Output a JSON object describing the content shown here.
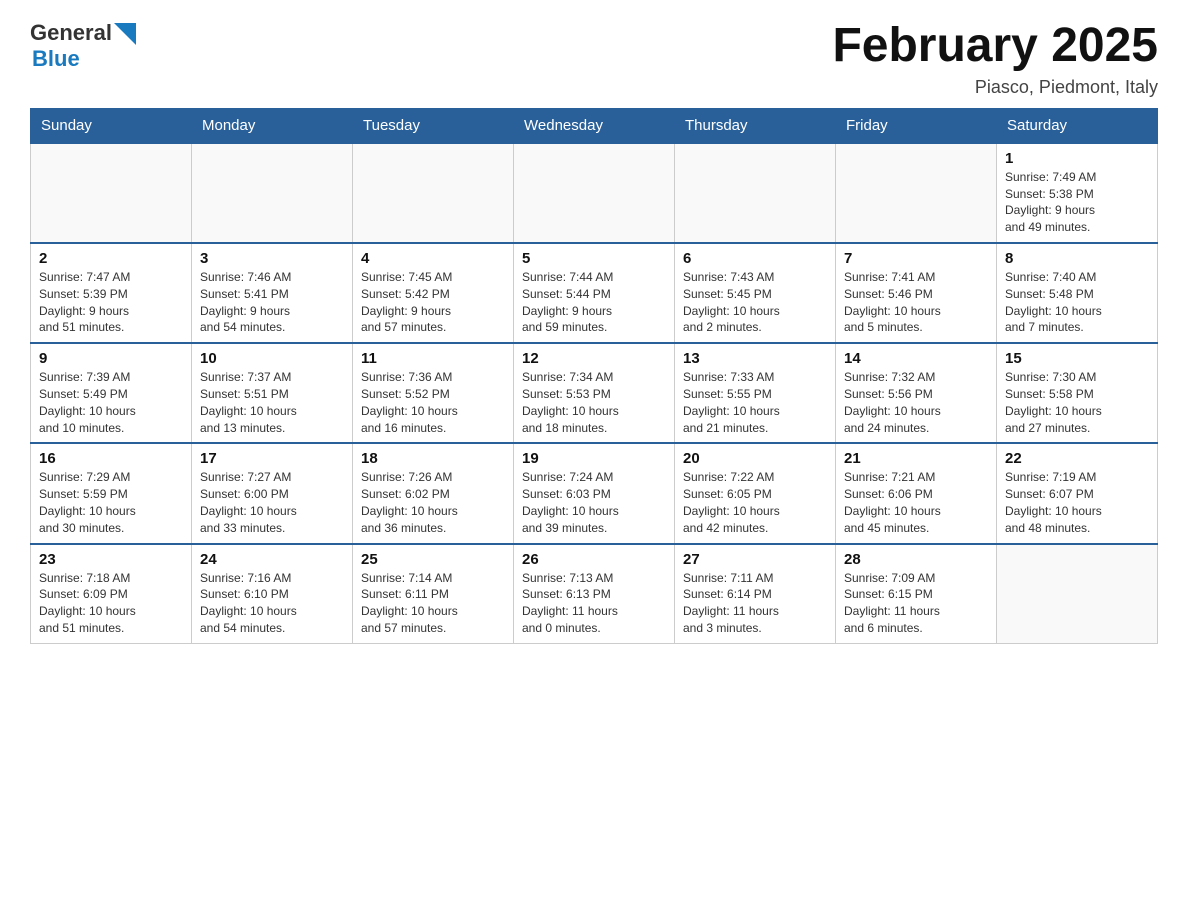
{
  "header": {
    "logo_general": "General",
    "logo_blue": "Blue",
    "month_title": "February 2025",
    "subtitle": "Piasco, Piedmont, Italy"
  },
  "weekdays": [
    "Sunday",
    "Monday",
    "Tuesday",
    "Wednesday",
    "Thursday",
    "Friday",
    "Saturday"
  ],
  "weeks": [
    [
      {
        "day": "",
        "info": ""
      },
      {
        "day": "",
        "info": ""
      },
      {
        "day": "",
        "info": ""
      },
      {
        "day": "",
        "info": ""
      },
      {
        "day": "",
        "info": ""
      },
      {
        "day": "",
        "info": ""
      },
      {
        "day": "1",
        "info": "Sunrise: 7:49 AM\nSunset: 5:38 PM\nDaylight: 9 hours\nand 49 minutes."
      }
    ],
    [
      {
        "day": "2",
        "info": "Sunrise: 7:47 AM\nSunset: 5:39 PM\nDaylight: 9 hours\nand 51 minutes."
      },
      {
        "day": "3",
        "info": "Sunrise: 7:46 AM\nSunset: 5:41 PM\nDaylight: 9 hours\nand 54 minutes."
      },
      {
        "day": "4",
        "info": "Sunrise: 7:45 AM\nSunset: 5:42 PM\nDaylight: 9 hours\nand 57 minutes."
      },
      {
        "day": "5",
        "info": "Sunrise: 7:44 AM\nSunset: 5:44 PM\nDaylight: 9 hours\nand 59 minutes."
      },
      {
        "day": "6",
        "info": "Sunrise: 7:43 AM\nSunset: 5:45 PM\nDaylight: 10 hours\nand 2 minutes."
      },
      {
        "day": "7",
        "info": "Sunrise: 7:41 AM\nSunset: 5:46 PM\nDaylight: 10 hours\nand 5 minutes."
      },
      {
        "day": "8",
        "info": "Sunrise: 7:40 AM\nSunset: 5:48 PM\nDaylight: 10 hours\nand 7 minutes."
      }
    ],
    [
      {
        "day": "9",
        "info": "Sunrise: 7:39 AM\nSunset: 5:49 PM\nDaylight: 10 hours\nand 10 minutes."
      },
      {
        "day": "10",
        "info": "Sunrise: 7:37 AM\nSunset: 5:51 PM\nDaylight: 10 hours\nand 13 minutes."
      },
      {
        "day": "11",
        "info": "Sunrise: 7:36 AM\nSunset: 5:52 PM\nDaylight: 10 hours\nand 16 minutes."
      },
      {
        "day": "12",
        "info": "Sunrise: 7:34 AM\nSunset: 5:53 PM\nDaylight: 10 hours\nand 18 minutes."
      },
      {
        "day": "13",
        "info": "Sunrise: 7:33 AM\nSunset: 5:55 PM\nDaylight: 10 hours\nand 21 minutes."
      },
      {
        "day": "14",
        "info": "Sunrise: 7:32 AM\nSunset: 5:56 PM\nDaylight: 10 hours\nand 24 minutes."
      },
      {
        "day": "15",
        "info": "Sunrise: 7:30 AM\nSunset: 5:58 PM\nDaylight: 10 hours\nand 27 minutes."
      }
    ],
    [
      {
        "day": "16",
        "info": "Sunrise: 7:29 AM\nSunset: 5:59 PM\nDaylight: 10 hours\nand 30 minutes."
      },
      {
        "day": "17",
        "info": "Sunrise: 7:27 AM\nSunset: 6:00 PM\nDaylight: 10 hours\nand 33 minutes."
      },
      {
        "day": "18",
        "info": "Sunrise: 7:26 AM\nSunset: 6:02 PM\nDaylight: 10 hours\nand 36 minutes."
      },
      {
        "day": "19",
        "info": "Sunrise: 7:24 AM\nSunset: 6:03 PM\nDaylight: 10 hours\nand 39 minutes."
      },
      {
        "day": "20",
        "info": "Sunrise: 7:22 AM\nSunset: 6:05 PM\nDaylight: 10 hours\nand 42 minutes."
      },
      {
        "day": "21",
        "info": "Sunrise: 7:21 AM\nSunset: 6:06 PM\nDaylight: 10 hours\nand 45 minutes."
      },
      {
        "day": "22",
        "info": "Sunrise: 7:19 AM\nSunset: 6:07 PM\nDaylight: 10 hours\nand 48 minutes."
      }
    ],
    [
      {
        "day": "23",
        "info": "Sunrise: 7:18 AM\nSunset: 6:09 PM\nDaylight: 10 hours\nand 51 minutes."
      },
      {
        "day": "24",
        "info": "Sunrise: 7:16 AM\nSunset: 6:10 PM\nDaylight: 10 hours\nand 54 minutes."
      },
      {
        "day": "25",
        "info": "Sunrise: 7:14 AM\nSunset: 6:11 PM\nDaylight: 10 hours\nand 57 minutes."
      },
      {
        "day": "26",
        "info": "Sunrise: 7:13 AM\nSunset: 6:13 PM\nDaylight: 11 hours\nand 0 minutes."
      },
      {
        "day": "27",
        "info": "Sunrise: 7:11 AM\nSunset: 6:14 PM\nDaylight: 11 hours\nand 3 minutes."
      },
      {
        "day": "28",
        "info": "Sunrise: 7:09 AM\nSunset: 6:15 PM\nDaylight: 11 hours\nand 6 minutes."
      },
      {
        "day": "",
        "info": ""
      }
    ]
  ]
}
